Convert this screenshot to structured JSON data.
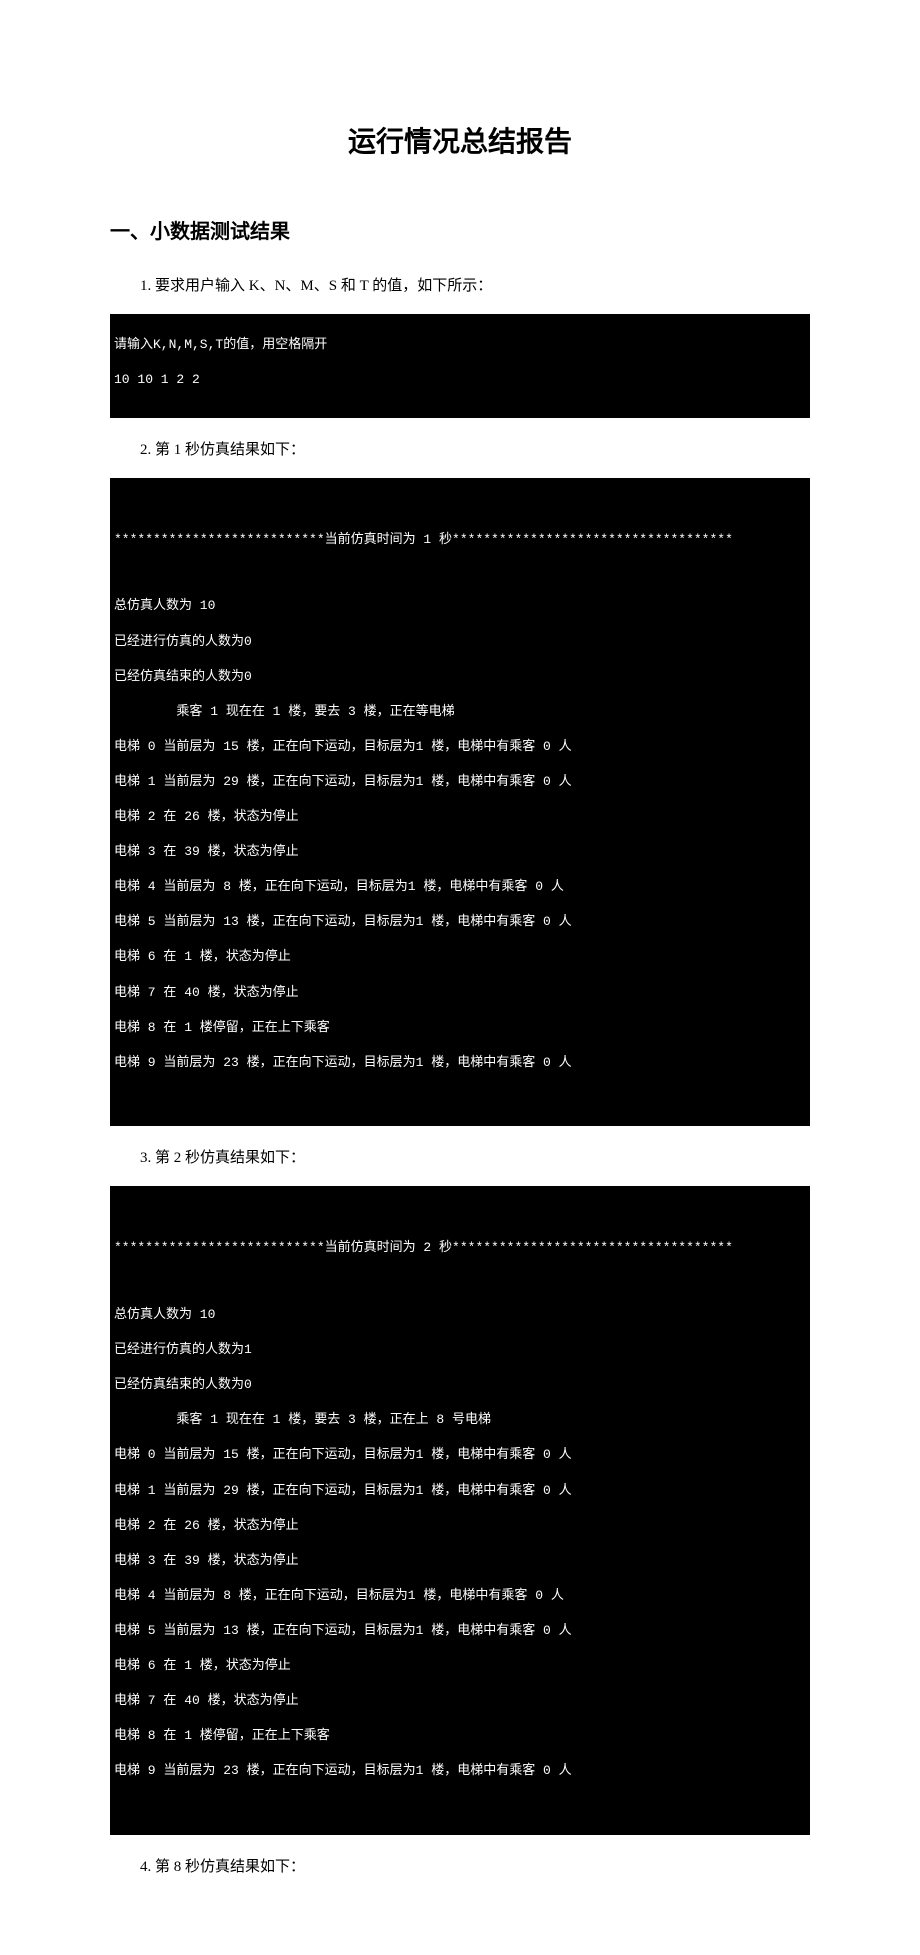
{
  "title": "运行情况总结报告",
  "section1": {
    "heading": "一、小数据测试结果",
    "item1": "1. 要求用户输入 K、N、M、S 和 T 的值，如下所示：",
    "term1": {
      "l0": "请输入K,N,M,S,T的值，用空格隔开",
      "l1": "10 10 1 2 2"
    },
    "item2": "2. 第 1 秒仿真结果如下：",
    "term2": {
      "l0": "***************************当前仿真时间为 1 秒************************************",
      "l1": "总仿真人数为 10",
      "l2": "已经进行仿真的人数为0",
      "l3": "已经仿真结束的人数为0",
      "l4": "        乘客 1 现在在 1 楼，要去 3 楼，正在等电梯",
      "l5": "电梯 0 当前层为 15 楼，正在向下运动，目标层为1 楼，电梯中有乘客 0 人",
      "l6": "电梯 1 当前层为 29 楼，正在向下运动，目标层为1 楼，电梯中有乘客 0 人",
      "l7": "电梯 2 在 26 楼，状态为停止",
      "l8": "电梯 3 在 39 楼，状态为停止",
      "l9": "电梯 4 当前层为 8 楼，正在向下运动，目标层为1 楼，电梯中有乘客 0 人",
      "l10": "电梯 5 当前层为 13 楼，正在向下运动，目标层为1 楼，电梯中有乘客 0 人",
      "l11": "电梯 6 在 1 楼，状态为停止",
      "l12": "电梯 7 在 40 楼，状态为停止",
      "l13": "电梯 8 在 1 楼停留，正在上下乘客",
      "l14": "电梯 9 当前层为 23 楼，正在向下运动，目标层为1 楼，电梯中有乘客 0 人"
    },
    "item3": "3. 第 2 秒仿真结果如下：",
    "term3": {
      "l0": "***************************当前仿真时间为 2 秒************************************",
      "l1": "总仿真人数为 10",
      "l2": "已经进行仿真的人数为1",
      "l3": "已经仿真结束的人数为0",
      "l4": "        乘客 1 现在在 1 楼，要去 3 楼，正在上 8 号电梯",
      "l5": "电梯 0 当前层为 15 楼，正在向下运动，目标层为1 楼，电梯中有乘客 0 人",
      "l6": "电梯 1 当前层为 29 楼，正在向下运动，目标层为1 楼，电梯中有乘客 0 人",
      "l7": "电梯 2 在 26 楼，状态为停止",
      "l8": "电梯 3 在 39 楼，状态为停止",
      "l9": "电梯 4 当前层为 8 楼，正在向下运动，目标层为1 楼，电梯中有乘客 0 人",
      "l10": "电梯 5 当前层为 13 楼，正在向下运动，目标层为1 楼，电梯中有乘客 0 人",
      "l11": "电梯 6 在 1 楼，状态为停止",
      "l12": "电梯 7 在 40 楼，状态为停止",
      "l13": "电梯 8 在 1 楼停留，正在上下乘客",
      "l14": "电梯 9 当前层为 23 楼，正在向下运动，目标层为1 楼，电梯中有乘客 0 人"
    },
    "item4": "4. 第 8 秒仿真结果如下："
  }
}
